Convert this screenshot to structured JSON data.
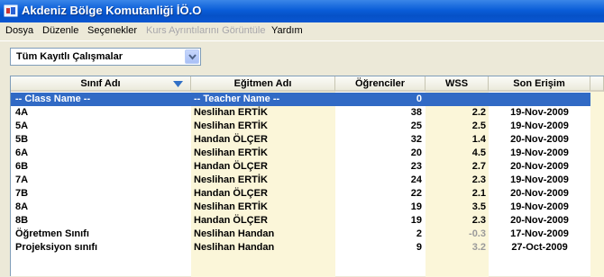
{
  "window": {
    "title": "Akdeniz Bölge Komutanliği İÖ.O"
  },
  "menu": {
    "dosya": "Dosya",
    "duzenle": "Düzenle",
    "secenekler": "Seçenekler",
    "kurs": "Kurs Ayrıntılarını Görüntüle",
    "yardim": "Yardım"
  },
  "filter": {
    "selected": "Tüm Kayıtlı Çalışmalar"
  },
  "table": {
    "headers": {
      "class": "Sınıf Adı",
      "teacher": "Eğitmen Adı",
      "students": "Öğrenciler",
      "wss": "WSS",
      "last": "Son Erişim"
    },
    "rows": [
      {
        "class": "-- Class Name --",
        "teacher": "-- Teacher Name --",
        "students": "0",
        "wss": "",
        "last": ""
      },
      {
        "class": "4A",
        "teacher": "Neslihan ERTİK",
        "students": "38",
        "wss": "2.2",
        "last": "19-Nov-2009"
      },
      {
        "class": "5A",
        "teacher": "Neslihan ERTİK",
        "students": "25",
        "wss": "2.5",
        "last": "19-Nov-2009"
      },
      {
        "class": "5B",
        "teacher": "Handan ÖLÇER",
        "students": "32",
        "wss": "1.4",
        "last": "20-Nov-2009"
      },
      {
        "class": "6A",
        "teacher": "Neslihan ERTİK",
        "students": "20",
        "wss": "4.5",
        "last": "19-Nov-2009"
      },
      {
        "class": "6B",
        "teacher": "Handan ÖLÇER",
        "students": "23",
        "wss": "2.7",
        "last": "20-Nov-2009"
      },
      {
        "class": "7A",
        "teacher": "Neslihan ERTİK",
        "students": "24",
        "wss": "2.3",
        "last": "19-Nov-2009"
      },
      {
        "class": "7B",
        "teacher": "Handan ÖLÇER",
        "students": "22",
        "wss": "2.1",
        "last": "20-Nov-2009"
      },
      {
        "class": "8A",
        "teacher": "Neslihan ERTİK",
        "students": "19",
        "wss": "3.5",
        "last": "19-Nov-2009"
      },
      {
        "class": "8B",
        "teacher": "Handan ÖLÇER",
        "students": "19",
        "wss": "2.3",
        "last": "20-Nov-2009"
      },
      {
        "class": "Öğretmen Sınıfı",
        "teacher": "Neslihan Handan",
        "students": "2",
        "wss": "-0.3",
        "last": "17-Nov-2009"
      },
      {
        "class": "Projeksiyon sınıfı",
        "teacher": "Neslihan Handan",
        "students": "9",
        "wss": "3.2",
        "last": "27-Oct-2009"
      }
    ]
  },
  "colors": {
    "titlebar": "#0A5DD8",
    "selection": "#316AC5",
    "alt_column": "#FBF6D9",
    "window_bg": "#ECE9D8"
  }
}
